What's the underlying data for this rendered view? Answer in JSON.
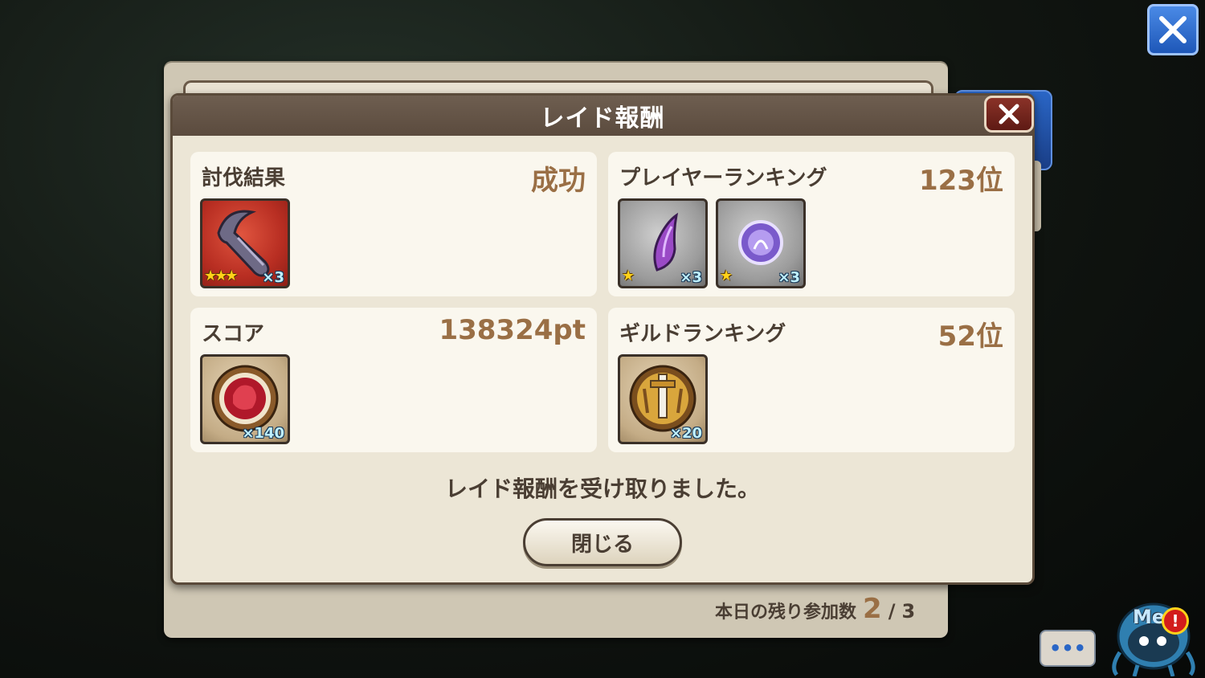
{
  "background": {
    "remaining_label": "本日の残り参加数",
    "remaining_current": "2",
    "remaining_separator": "/",
    "remaining_max": "3"
  },
  "dialog": {
    "title": "レイド報酬",
    "message": "レイド報酬を受け取りました。",
    "close_button": "閉じる"
  },
  "cards": {
    "subjugation": {
      "title": "討伐結果",
      "value": "成功",
      "items": [
        {
          "icon": "claw-item-icon",
          "stars": "★★★",
          "quantity": "×3"
        }
      ]
    },
    "player_ranking": {
      "title": "プレイヤーランキング",
      "value": "123位",
      "items": [
        {
          "icon": "purple-crystal-icon",
          "stars": "★",
          "quantity": "×3"
        },
        {
          "icon": "purple-orb-icon",
          "stars": "★",
          "quantity": "×3"
        }
      ]
    },
    "score": {
      "title": "スコア",
      "value": "138324pt",
      "items": [
        {
          "icon": "red-gem-medal-icon",
          "quantity": "×140"
        }
      ]
    },
    "guild_ranking": {
      "title": "ギルドランキング",
      "value": "52位",
      "items": [
        {
          "icon": "gold-sword-medal-icon",
          "quantity": "×20"
        }
      ]
    }
  },
  "overlay": {
    "chat_dots": "•••",
    "mascot_label": "Me",
    "alert_mark": "!"
  },
  "colors": {
    "accent_value": "#9a6f45",
    "text_dark": "#4a3e33",
    "header_brown": "#5b4b3e",
    "close_blue": "#1e57b8"
  }
}
